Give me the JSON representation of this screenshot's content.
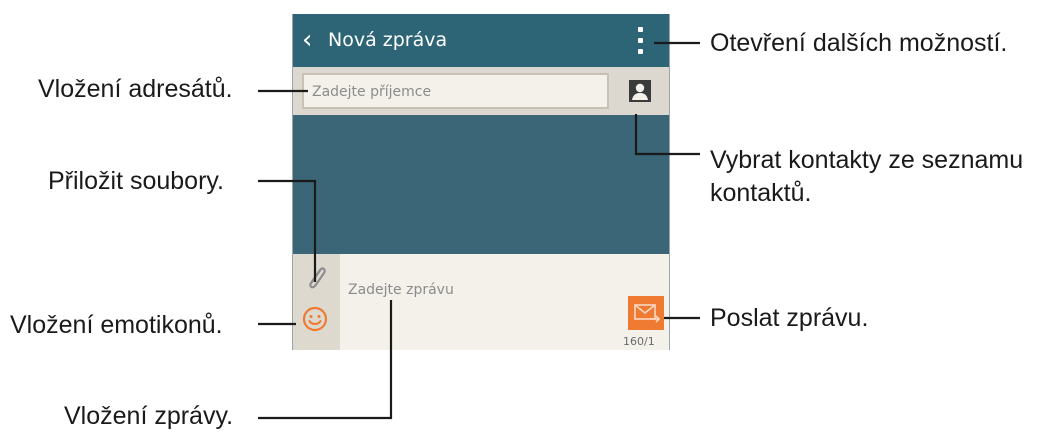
{
  "app_bar": {
    "back_icon": "chevron-left-icon",
    "title": "Nová zpráva",
    "menu_icon": "more-vertical-icon"
  },
  "recipient": {
    "placeholder": "Zadejte příjemce",
    "contacts_icon": "contact-card-icon"
  },
  "composer": {
    "attach_icon": "paperclip-icon",
    "emoticon_icon": "smiley-icon",
    "placeholder": "Zadejte zprávu",
    "send_icon": "send-envelope-icon",
    "counter": "160/1"
  },
  "colors": {
    "app_bar": "#2d6576",
    "background": "#3b6677",
    "compose_area": "#f3f1ea",
    "send_button": "#ef7b33"
  },
  "callouts": {
    "more_options": "Otevření dalších možností.",
    "insert_recipients": "Vložení adresátů.",
    "select_contacts_line1": "Vybrat kontakty ze seznamu",
    "select_contacts_line2": "kontaktů.",
    "attach_files": "Přiložit soubory.",
    "send_message": "Poslat zprávu.",
    "insert_emoticons": "Vložení emotikonů.",
    "enter_message": "Vložení zprávy."
  }
}
